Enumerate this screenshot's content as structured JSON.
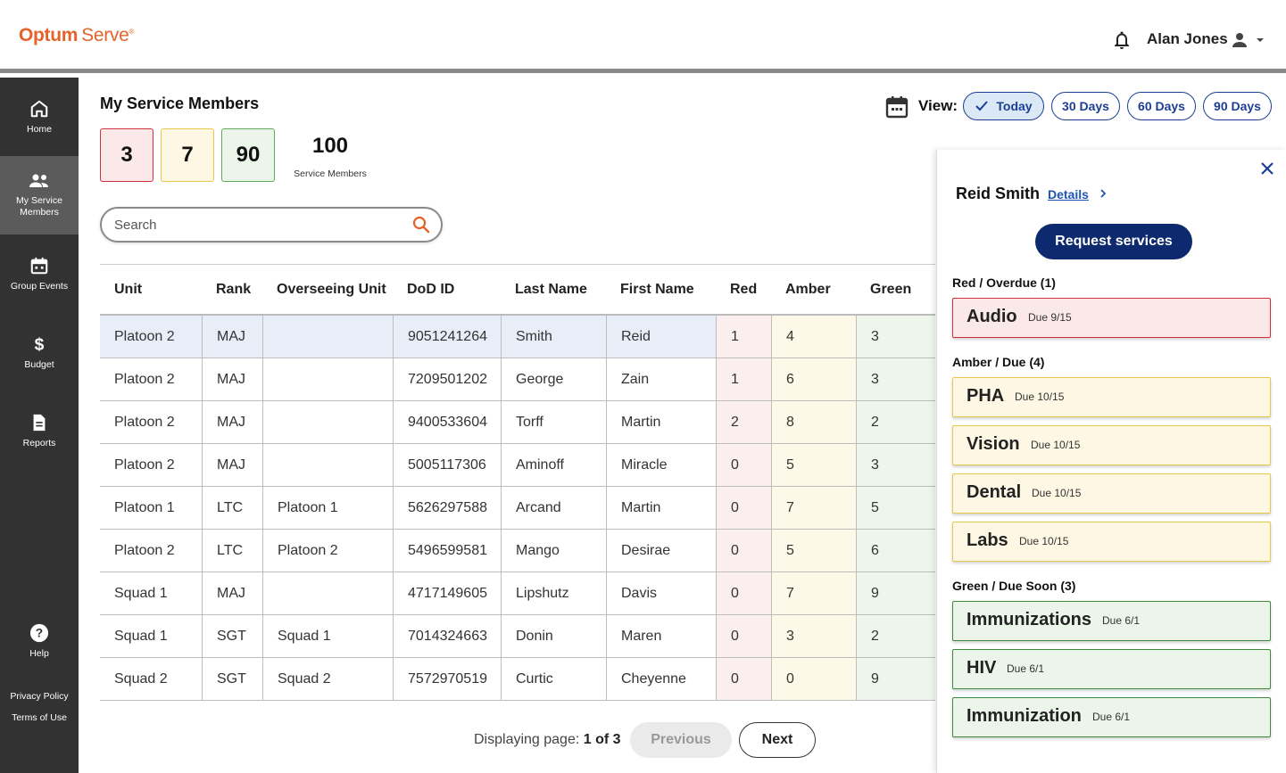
{
  "app": {
    "logo_main": "Optum",
    "logo_sub": "Serve",
    "logo_mark": "®"
  },
  "header": {
    "user_name": "Alan Jones"
  },
  "sidebar": {
    "items": [
      {
        "label": "Home",
        "icon": "home-icon"
      },
      {
        "label": "My Service Members",
        "icon": "people-icon",
        "active": true
      },
      {
        "label": "Group Events",
        "icon": "calendar-icon"
      },
      {
        "label": "Budget",
        "icon": "dollar-icon"
      },
      {
        "label": "Reports",
        "icon": "document-icon"
      }
    ],
    "help": "Help",
    "privacy": "Privacy Policy",
    "terms": "Terms of Use"
  },
  "main": {
    "title": "My Service Members",
    "counts": {
      "red": "3",
      "amber": "7",
      "green": "90",
      "total": "100",
      "total_label": "Service Members"
    },
    "search_placeholder": "Search",
    "view": {
      "label": "View:",
      "options": [
        "Today",
        "30 Days",
        "60 Days",
        "90 Days"
      ],
      "selected": "Today"
    }
  },
  "table": {
    "columns": [
      "Unit",
      "Rank",
      "Overseeing Unit",
      "DoD ID",
      "Last Name",
      "First Name",
      "Red",
      "Amber",
      "Green"
    ],
    "rows": [
      [
        "Platoon 2",
        "MAJ",
        "",
        "9051241264",
        "Smith",
        "Reid",
        "1",
        "4",
        "3"
      ],
      [
        "Platoon 2",
        "MAJ",
        "",
        "7209501202",
        "George",
        "Zain",
        "1",
        "6",
        "3"
      ],
      [
        "Platoon 2",
        "MAJ",
        "",
        "9400533604",
        "Torff",
        "Martin",
        "2",
        "8",
        "2"
      ],
      [
        "Platoon 2",
        "MAJ",
        "",
        "5005117306",
        "Aminoff",
        "Miracle",
        "0",
        "5",
        "3"
      ],
      [
        "Platoon 1",
        "LTC",
        "Platoon 1",
        "5626297588",
        "Arcand",
        "Martin",
        "0",
        "7",
        "5"
      ],
      [
        "Platoon 2",
        "LTC",
        "Platoon 2",
        "5496599581",
        "Mango",
        "Desirae",
        "0",
        "5",
        "6"
      ],
      [
        "Squad 1",
        "MAJ",
        "",
        "4717149605",
        "Lipshutz",
        "Davis",
        "0",
        "7",
        "9"
      ],
      [
        "Squad 1",
        "SGT",
        "Squad 1",
        "7014324663",
        "Donin",
        "Maren",
        "0",
        "3",
        "2"
      ],
      [
        "Squad 2",
        "SGT",
        "Squad 2",
        "7572970519",
        "Curtic",
        "Cheyenne",
        "0",
        "0",
        "9"
      ]
    ],
    "selected_row": 0
  },
  "pager": {
    "prefix": "Displaying page:",
    "current": "1 of 3",
    "prev": "Previous",
    "next": "Next"
  },
  "drawer": {
    "name": "Reid Smith",
    "details": "Details",
    "request": "Request services",
    "groups": [
      {
        "title": "Red / Overdue (1)",
        "tone": "red",
        "items": [
          {
            "name": "Audio",
            "due": "Due 9/15"
          }
        ]
      },
      {
        "title": "Amber / Due (4)",
        "tone": "amber",
        "items": [
          {
            "name": "PHA",
            "due": "Due 10/15"
          },
          {
            "name": "Vision",
            "due": "Due 10/15"
          },
          {
            "name": "Dental",
            "due": "Due 10/15"
          },
          {
            "name": "Labs",
            "due": "Due 10/15"
          }
        ]
      },
      {
        "title": "Green / Due Soon (3)",
        "tone": "green",
        "items": [
          {
            "name": "Immunizations",
            "due": "Due 6/1"
          },
          {
            "name": "HIV",
            "due": "Due 6/1"
          },
          {
            "name": "Immunization",
            "due": "Due 6/1"
          }
        ]
      }
    ]
  },
  "colors": {
    "brand": "#e3632b",
    "navy": "#0e2a6e",
    "link": "#1c55b5",
    "red": "#d4313e",
    "amber": "#e8c84a",
    "green": "#3f8a3b"
  }
}
